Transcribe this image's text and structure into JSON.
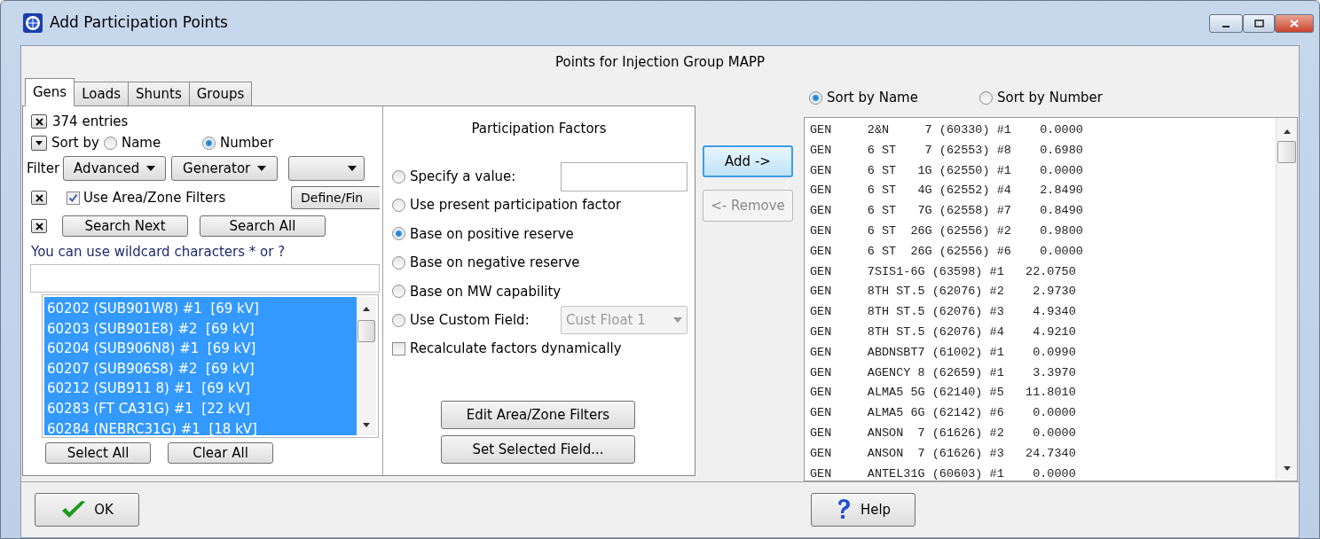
{
  "window": {
    "title": "Add Participation Points"
  },
  "header": "Points for Injection Group MAPP",
  "tabs": [
    {
      "label": "Gens",
      "selected": true
    },
    {
      "label": "Loads",
      "selected": false
    },
    {
      "label": "Shunts",
      "selected": false
    },
    {
      "label": "Groups",
      "selected": false
    }
  ],
  "object_list": {
    "entries": "374 entries",
    "sort": {
      "label": "Sort by",
      "options": [
        {
          "label": "Name",
          "selected": false
        },
        {
          "label": "Number",
          "selected": true
        }
      ]
    },
    "filter": {
      "label": "Filter",
      "combos": [
        "Advanced",
        "Generator"
      ]
    },
    "area_zone": {
      "label": "Use Area/Zone Filters",
      "checked": true
    },
    "define_button": "Define/Fin",
    "search_buttons": [
      "Search Next",
      "Search All"
    ],
    "hint": "You can use wildcard characters * or ?",
    "items": [
      {
        "text": "60202 (SUB901W8) #1  [69 kV]",
        "selected": true
      },
      {
        "text": "60203 (SUB901E8) #2  [69 kV]",
        "selected": true
      },
      {
        "text": "60204 (SUB906N8) #1  [69 kV]",
        "selected": true
      },
      {
        "text": "60207 (SUB906S8) #2  [69 kV]",
        "selected": true
      },
      {
        "text": "60212 (SUB911 8) #1  [69 kV]",
        "selected": true
      },
      {
        "text": "60283 (FT CA31G) #1  [22 kV]",
        "selected": true
      },
      {
        "text": "60284 (NEBRC31G) #1  [18 kV]",
        "selected": true
      }
    ],
    "buttons": [
      "Select All",
      "Clear All"
    ]
  },
  "participation": {
    "title": "Participation Factors",
    "options": [
      {
        "label": "Specify a value:",
        "selected": false,
        "kind": "field"
      },
      {
        "label": "Use present participation factor",
        "selected": false,
        "kind": "plain"
      },
      {
        "label": "Base on positive reserve",
        "selected": true,
        "kind": "plain"
      },
      {
        "label": "Base on negative reserve",
        "selected": false,
        "kind": "plain"
      },
      {
        "label": "Base on MW capability",
        "selected": false,
        "kind": "plain"
      },
      {
        "label": "Use Custom Field:",
        "selected": false,
        "kind": "combo",
        "value": "Cust Float 1",
        "disabled": true
      }
    ],
    "recalculate": {
      "label": "Recalculate factors dynamically",
      "checked": false
    },
    "buttons": [
      "Edit Area/Zone Filters",
      "Set Selected Field..."
    ]
  },
  "transfer_buttons": [
    {
      "label": "Add ->",
      "disabled": false
    },
    {
      "label": "<- Remove",
      "disabled": true
    }
  ],
  "points": {
    "sort_options": [
      {
        "label": "Sort by Name",
        "selected": true
      },
      {
        "label": "Sort by Number",
        "selected": false
      }
    ],
    "rows": [
      "GEN     2&N     7 (60330) #1    0.0000",
      "GEN     6 ST    7 (62553) #8    0.6980",
      "GEN     6 ST   1G (62550) #1    0.0000",
      "GEN     6 ST   4G (62552) #4    2.8490",
      "GEN     6 ST   7G (62558) #7    0.8490",
      "GEN     6 ST  26G (62556) #2    0.9800",
      "GEN     6 ST  26G (62556) #6    0.0000",
      "GEN     7SIS1-6G (63598) #1   22.0750",
      "GEN     8TH ST.5 (62076) #2    2.9730",
      "GEN     8TH ST.5 (62076) #3    4.9340",
      "GEN     8TH ST.5 (62076) #4    4.9210",
      "GEN     ABDNSBT7 (61002) #1    0.0990",
      "GEN     AGENCY 8 (62659) #1    3.3970",
      "GEN     ALMA5 5G (62140) #5   11.8010",
      "GEN     ALMA5 6G (62142) #6    0.0000",
      "GEN     ANSON  7 (61626) #2    0.0000",
      "GEN     ANSON  7 (61626) #3   24.7340",
      "GEN     ANTEL31G (60603) #1    0.0000"
    ]
  },
  "footer": {
    "ok": "OK",
    "help": "Help"
  }
}
